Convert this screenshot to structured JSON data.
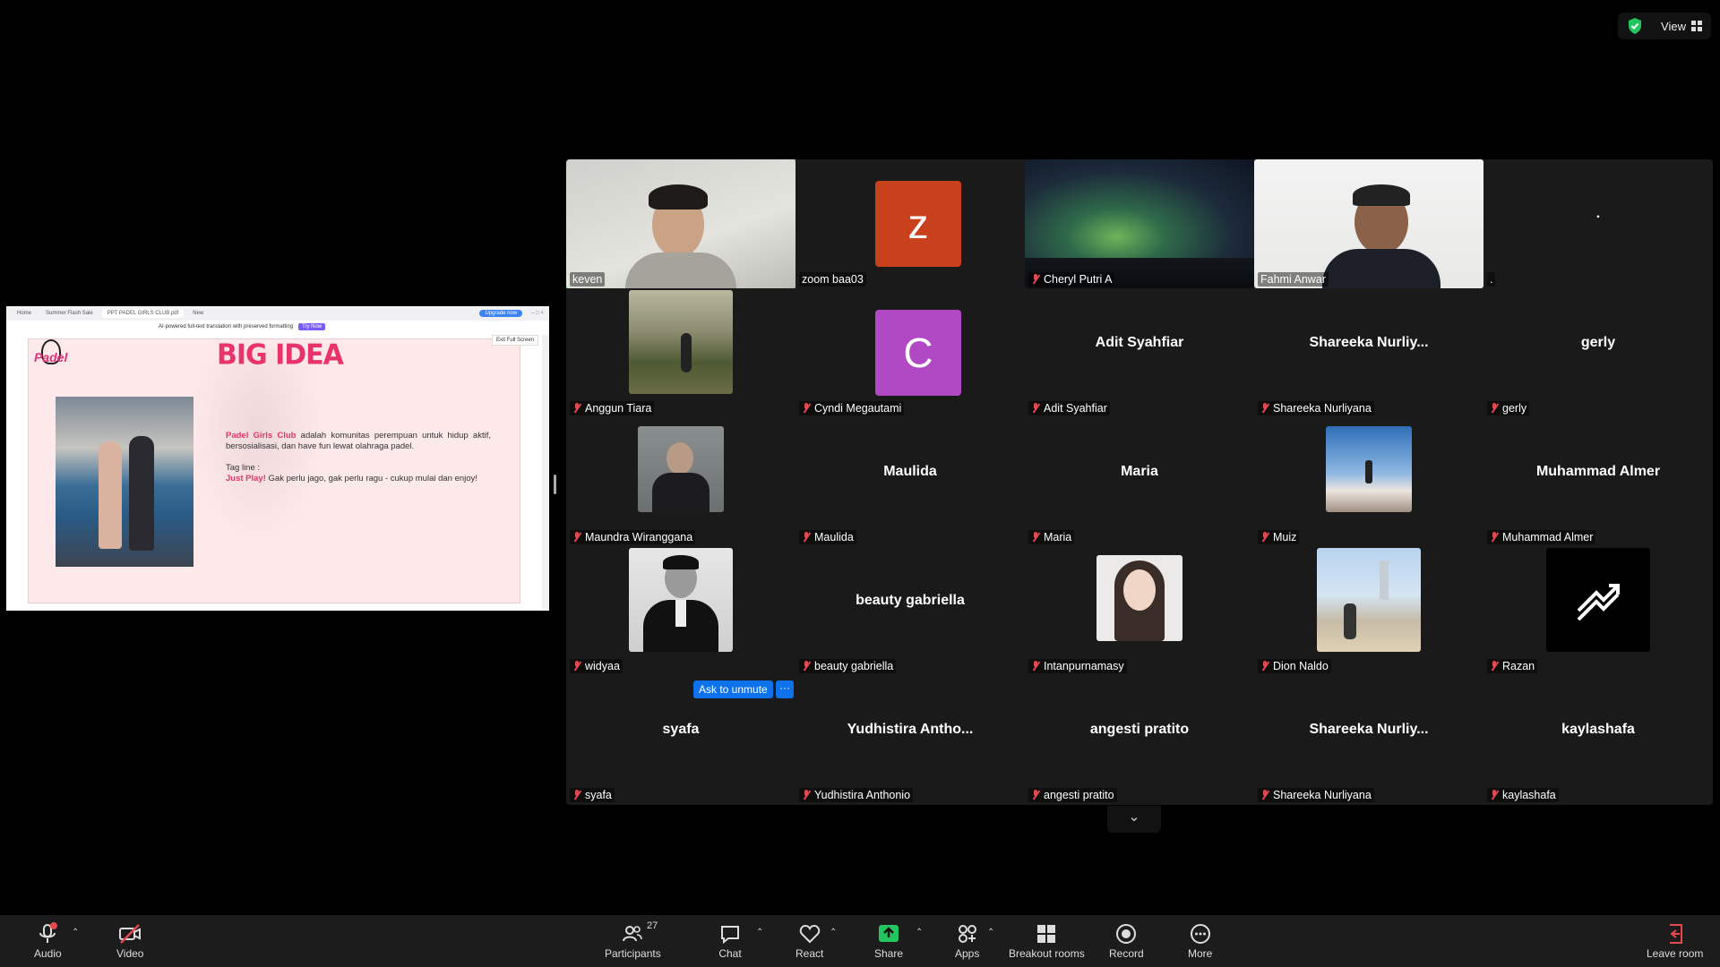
{
  "topbar": {
    "view_label": "View"
  },
  "share": {
    "tabs": [
      "Home",
      "Summer Flash Sale",
      "PPT PADEL GIRLS CLUB.pdf",
      "New"
    ],
    "upgrade_label": "Upgrade now",
    "banner_text": "AI-powered full-text translation with preserved formatting",
    "try_label": "Try Now",
    "exit_label": "Exit Full Screen",
    "slide": {
      "logo": "Padel",
      "title": "BIG IDEA",
      "brand": "Padel Girls Club",
      "desc": "adalah komunitas perempuan untuk hidup aktif, bersosialisasi, dan have fun lewat olahraga padel.",
      "tagline_label": "Tag line :",
      "tagline_bold": "Just Play!",
      "tagline_rest": "Gak perlu jago, gak perlu ragu - cukup mulai dan enjoy!"
    }
  },
  "participants": [
    {
      "name": "keven",
      "kind": "video-keven",
      "muted": false
    },
    {
      "name": "zoom baa03",
      "kind": "letter",
      "letter": "z",
      "color": "#c9401c",
      "muted": false
    },
    {
      "name": "Cheryl Putri A",
      "kind": "aurora",
      "muted": true
    },
    {
      "name": "Fahmi Anwar",
      "kind": "video-fahmi",
      "muted": false
    },
    {
      "name": ".",
      "kind": "blank",
      "center": ".",
      "muted": false
    },
    {
      "name": "Anggun Tiara",
      "kind": "photo-landscape",
      "muted": true
    },
    {
      "name": "Cyndi Megautami",
      "kind": "letter",
      "letter": "C",
      "color": "#b149c4",
      "muted": true
    },
    {
      "name": "Adit Syahfiar",
      "kind": "text",
      "center": "Adit Syahfiar",
      "muted": true
    },
    {
      "name": "Shareeka Nurliyana",
      "kind": "text",
      "center": "Shareeka  Nurliy...",
      "muted": true
    },
    {
      "name": "gerly",
      "kind": "text",
      "center": "gerly",
      "muted": true
    },
    {
      "name": "Maundra Wiranggana",
      "kind": "photo-man",
      "muted": true
    },
    {
      "name": "Maulida",
      "kind": "text",
      "center": "Maulida",
      "muted": true
    },
    {
      "name": "Maria",
      "kind": "text",
      "center": "Maria",
      "muted": true
    },
    {
      "name": "Muiz",
      "kind": "photo-mountain",
      "muted": true
    },
    {
      "name": "Muhammad Almer",
      "kind": "text",
      "center": "Muhammad Almer",
      "muted": true
    },
    {
      "name": "widyaa",
      "kind": "photo-suit",
      "muted": true
    },
    {
      "name": "beauty gabriella",
      "kind": "text",
      "center": "beauty gabriella",
      "muted": true
    },
    {
      "name": "Intanpurnamasy",
      "kind": "photo-girl",
      "muted": true
    },
    {
      "name": "Dion Naldo",
      "kind": "photo-beach",
      "muted": true
    },
    {
      "name": "Razan",
      "kind": "logo",
      "muted": true
    },
    {
      "name": "syafa",
      "kind": "text",
      "center": "syafa",
      "muted": true
    },
    {
      "name": "Yudhistira Anthonio",
      "kind": "text",
      "center": "Yudhistira  Antho...",
      "muted": true
    },
    {
      "name": "angesti pratito",
      "kind": "text",
      "center": "angesti pratito",
      "muted": true
    },
    {
      "name": "Shareeka Nurliyana",
      "kind": "text",
      "center": "Shareeka  Nurliy...",
      "muted": true
    },
    {
      "name": "kaylashafa",
      "kind": "text",
      "center": "kaylashafa",
      "muted": true
    }
  ],
  "ask_unmute": "Ask to unmute",
  "ask_more": "···",
  "toolbar": {
    "audio": "Audio",
    "video": "Video",
    "participants": "Participants",
    "participants_count": "27",
    "chat": "Chat",
    "react": "React",
    "share": "Share",
    "apps": "Apps",
    "breakout": "Breakout rooms",
    "record": "Record",
    "more": "More",
    "leave": "Leave room"
  }
}
